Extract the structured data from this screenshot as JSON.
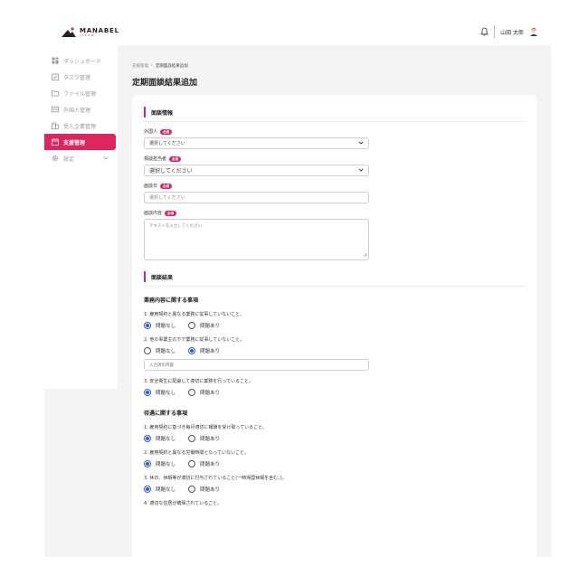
{
  "brand": {
    "name": "MANABEL",
    "tagline": "JAPAN",
    "accent": "#e0245e"
  },
  "header": {
    "user_name": "山田 太郎"
  },
  "sidebar": {
    "items": [
      {
        "label": "ダッシュボード",
        "icon": "dashboard-icon"
      },
      {
        "label": "タスク管理",
        "icon": "task-icon"
      },
      {
        "label": "ファイル管理",
        "icon": "folder-icon"
      },
      {
        "label": "外国人管理",
        "icon": "id-card-icon"
      },
      {
        "label": "受入企業管理",
        "icon": "building-icon"
      },
      {
        "label": "支援管理",
        "icon": "calendar-icon",
        "active": true
      },
      {
        "label": "設定",
        "icon": "gear-icon"
      }
    ]
  },
  "breadcrumb": {
    "parent": "支援管理",
    "separator": "›",
    "current": "定期面談結果追加"
  },
  "page_title": "定期面談結果追加",
  "interview_info": {
    "heading": "面談情報",
    "required_badge": "必須",
    "foreigner": {
      "label": "外国人",
      "value": "選択してください"
    },
    "staff": {
      "label": "相談担当者",
      "value": "選択してください"
    },
    "date": {
      "label": "面談日",
      "placeholder": "選択してください"
    },
    "content": {
      "label": "面談内容",
      "placeholder": "テキストを入力してください"
    }
  },
  "results": {
    "heading": "面談結果",
    "work": {
      "title": "業務内容に関する事項",
      "q1": {
        "text": "1. 雇用契約と異なる業務に従事していないこと。",
        "yes": "問題なし",
        "no": "問題あり",
        "selected": "問題なし"
      },
      "q2": {
        "text": "2. 他の事業主の下で業務に従事していないこと。",
        "yes": "問題なし",
        "no": "問題あり",
        "selected": "問題あり",
        "detail_placeholder": "入力済の内容"
      },
      "q3": {
        "text": "3. 安全衛生に配慮して適切に業務を行っていること。",
        "yes": "問題なし",
        "no": "問題あり",
        "selected": "問題なし"
      }
    },
    "treatment": {
      "title": "待遇に関する事項",
      "q1": {
        "text": "1. 雇用契約に基づき毎月適切に報酬を受け取っていること。",
        "yes": "問題なし",
        "no": "問題あり",
        "selected": "問題なし"
      },
      "q2": {
        "text": "2. 雇用契約と異なる労働時間となっていないこと。",
        "yes": "問題なし",
        "no": "問題あり",
        "selected": "問題なし"
      },
      "q3": {
        "text": "3. 休日、休暇等が適切に付与されていること(一時帰国休暇を含む。)。",
        "yes": "問題なし",
        "no": "問題あり",
        "selected": "問題なし"
      },
      "q4": {
        "text": "4. 適切な住居が確保されていること。"
      }
    }
  }
}
